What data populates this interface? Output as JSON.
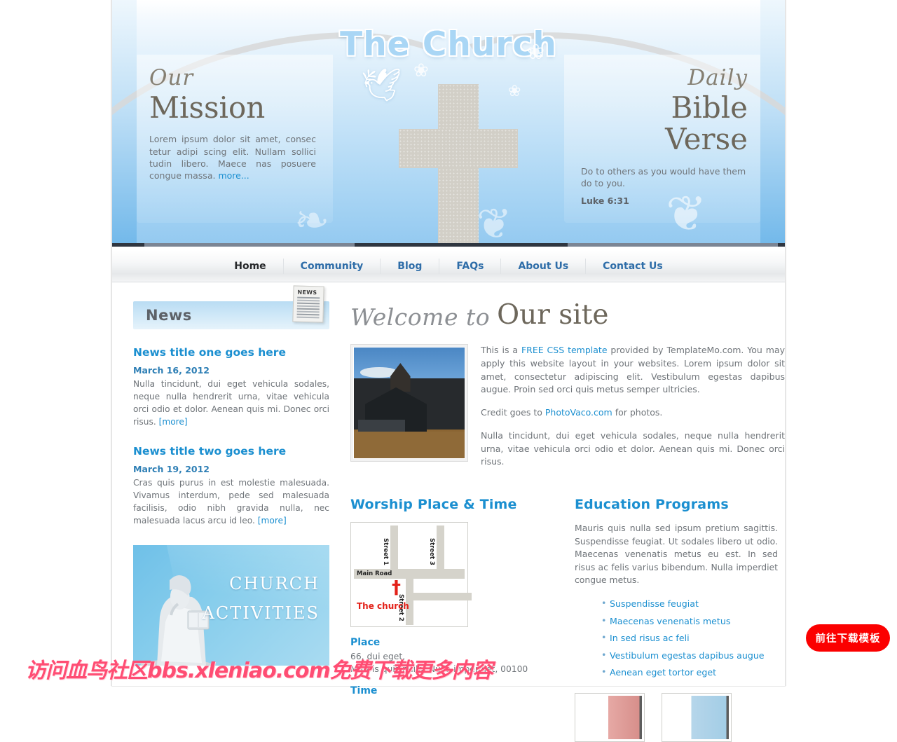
{
  "site": {
    "title": "The Church"
  },
  "mission": {
    "script_word": "Our",
    "heading": "Mission",
    "body": "Lorem ipsum dolor sit amet, consec tetur adipi scing elit. Nullam sollici tudin libero. Maece nas posuere congue massa. ",
    "more_label": "more..."
  },
  "verse": {
    "script_word": "Daily",
    "heading": "Bible Verse",
    "text": "Do to others as you would have them do to you.",
    "reference": "Luke 6:31"
  },
  "nav": {
    "items": [
      {
        "label": "Home",
        "active": true
      },
      {
        "label": "Community",
        "active": false
      },
      {
        "label": "Blog",
        "active": false
      },
      {
        "label": "FAQs",
        "active": false
      },
      {
        "label": "About Us",
        "active": false
      },
      {
        "label": "Contact Us",
        "active": false
      }
    ]
  },
  "news": {
    "heading": "News",
    "icon_label": "NEWS",
    "items": [
      {
        "title": "News title one goes here",
        "date": "March 16, 2012",
        "body": "Nulla tincidunt, dui eget vehicula sodales, neque nulla hendrerit urna, vitae vehicula orci odio et dolor. Aenean quis mi. Donec orci risus. ",
        "more_label": "[more]"
      },
      {
        "title": "News title two goes here",
        "date": "March 19, 2012",
        "body": "Cras quis purus in est molestie malesuada. Vivamus interdum, pede sed malesuada facilisis, odio nibh gravida nulla, nec malesuada lacus arcu id leo. ",
        "more_label": "[more]"
      }
    ]
  },
  "activities_banner": {
    "line1": "CHURCH",
    "line2": "ACTIVITIES"
  },
  "welcome": {
    "script_part": "Welcome to",
    "serif_part": "Our site"
  },
  "intro": {
    "p1_a": "This is a ",
    "p1_link": "FREE CSS template",
    "p1_b": " provided by TemplateMo.com. You may apply this website layout in your websites. Lorem ipsum dolor sit amet, consectetur adipiscing elit. Vestibulum egestas dapibus augue. Proin sed orci quis metus semper ultricies.",
    "p2_a": "Credit goes to ",
    "p2_link": "PhotoVaco.com",
    "p2_b": " for photos.",
    "p3": "Nulla tincidunt, dui eget vehicula sodales, neque nulla hendrerit urna, vitae vehicula orci odio et dolor. Aenean quis mi. Donec orci risus."
  },
  "worship": {
    "heading": "Worship Place & Time",
    "map": {
      "main_road": "Main Road",
      "street1": "Street 1",
      "street2": "Street 2",
      "street3": "Street 3",
      "church_label": "The church",
      "church_marker": "†"
    },
    "place_heading": "Place",
    "address_line1": "66, dui eget,",
    "address_line2": "Mauris quis nulla, Nulla imperdiet, 00100",
    "time_heading": "Time"
  },
  "education": {
    "heading": "Education Programs",
    "body": "Mauris quis nulla sed ipsum pretium sagittis. Suspendisse feugiat. Ut sodales libero ut odio. Maecenas venenatis metus eu est. In sed risus ac felis varius bibendum. Nulla imperdiet congue metus.",
    "bullets": [
      "Suspendisse feugiat",
      "Maecenas venenatis metus",
      "In sed risus ac feli",
      "Vestibulum egestas dapibus augue",
      "Aenean eget tortor eget"
    ]
  },
  "overlay": {
    "watermark": "访问血鸟社区bbs.xleniao.com免费下载更多内容",
    "download_button": "前往下载模板"
  },
  "colors": {
    "accent_blue": "#1b8fd0",
    "nav_link": "#2e6da8",
    "stone": "#6d675b",
    "red_button": "#fb0000",
    "watermark_pink": "#ff4d73"
  }
}
